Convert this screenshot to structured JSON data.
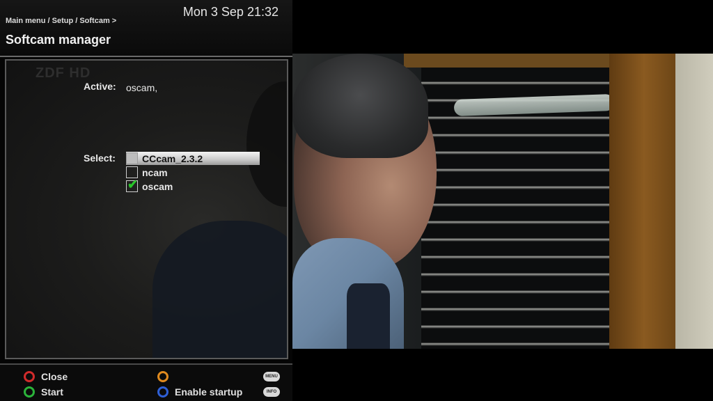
{
  "header": {
    "clock": "Mon 3 Sep 21:32",
    "breadcrumb": "Main menu / Setup / Softcam >",
    "title": "Softcam manager"
  },
  "channel_logo": "ZDF HD",
  "active": {
    "label": "Active:",
    "value": "oscam,"
  },
  "select": {
    "label": "Select:",
    "items": [
      {
        "name": "CCcam_2.3.2",
        "checked": false,
        "selected": true
      },
      {
        "name": "ncam",
        "checked": false,
        "selected": false
      },
      {
        "name": "oscam",
        "checked": true,
        "selected": false
      }
    ]
  },
  "footer": {
    "red_label": "Close",
    "green_label": "Start",
    "yellow_label": "",
    "blue_label": "Enable startup",
    "menu_pill": "MENU",
    "info_pill": "INFO"
  },
  "colors": {
    "red": "#d02b2b",
    "green": "#2bb33a",
    "yellow": "#e08a1e",
    "blue": "#2e5fd6",
    "check": "#29c629"
  },
  "icons": {
    "checkmark": "✔"
  }
}
